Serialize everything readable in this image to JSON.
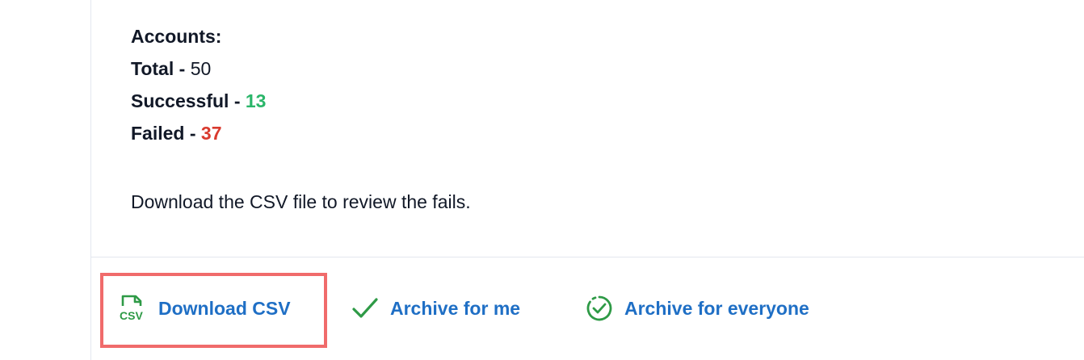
{
  "summary": {
    "heading": "Accounts:",
    "total_label": "Total -",
    "total_value": "50",
    "successful_label": "Successful -",
    "successful_value": "13",
    "failed_label": "Failed -",
    "failed_value": "37"
  },
  "note": "Download the CSV file to review the fails.",
  "actions": {
    "download_csv": {
      "label": "Download CSV",
      "icon": "csv-file-icon"
    },
    "archive_for_me": {
      "label": "Archive for me",
      "icon": "check-icon"
    },
    "archive_for_everyone": {
      "label": "Archive for everyone",
      "icon": "check-circle-dashed-icon"
    }
  },
  "colors": {
    "text": "#111827",
    "success": "#2bb66a",
    "fail": "#d93a2e",
    "link": "#1f6fc5",
    "icon_green": "#2e9a46",
    "highlight": "#f06b6b",
    "divider": "#e3e7ef"
  }
}
